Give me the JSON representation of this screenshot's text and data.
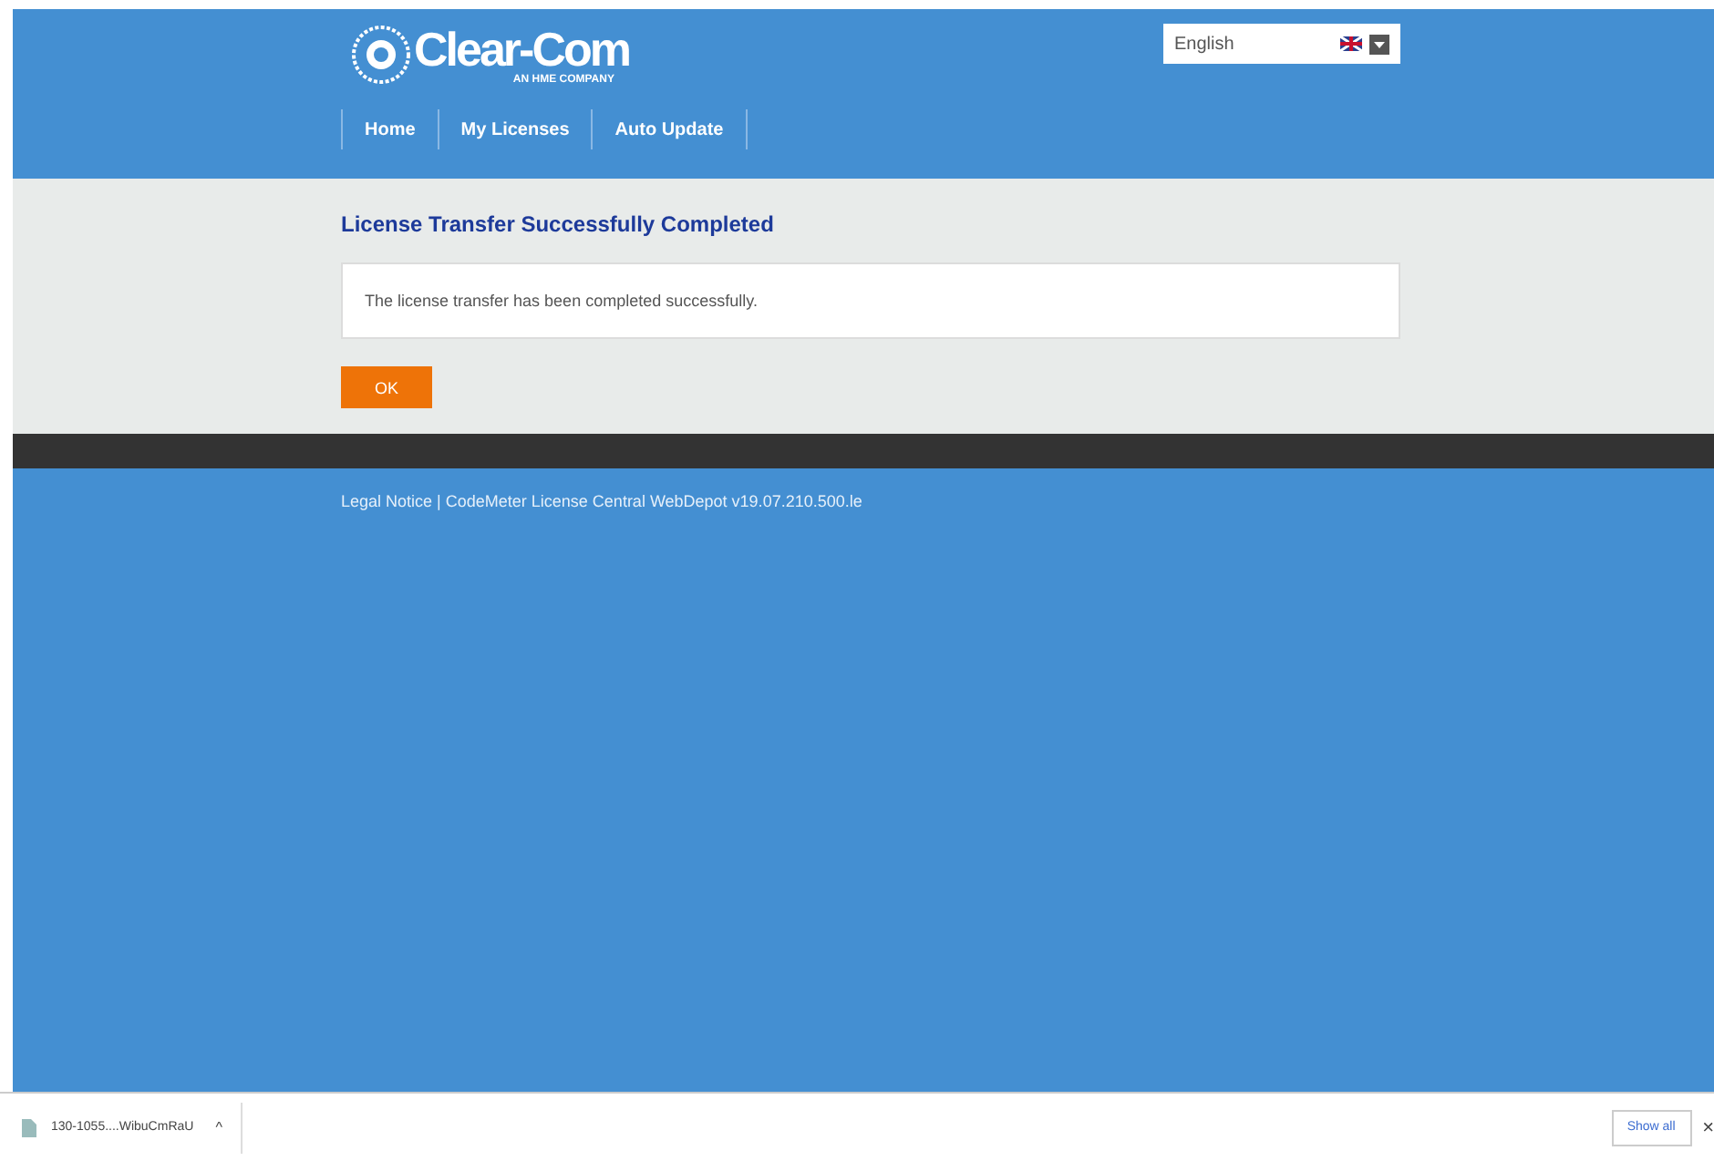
{
  "logo": {
    "name": "Clear-Com",
    "tagline": "AN HME COMPANY"
  },
  "language": {
    "value": "English"
  },
  "nav": [
    {
      "label": "Home"
    },
    {
      "label": "My Licenses"
    },
    {
      "label": "Auto Update"
    }
  ],
  "heading": "License Transfer Successfully Completed",
  "message": "The license transfer has been completed successfully.",
  "ok_button": "OK",
  "footer": {
    "link": "Legal Notice",
    "text": "| CodeMeter License Central WebDepot v19.07.210.500.le"
  },
  "downloads": {
    "file": "130-1055....WibuCmRaU",
    "caret": "^",
    "show_all": "Show all",
    "close": "×"
  }
}
